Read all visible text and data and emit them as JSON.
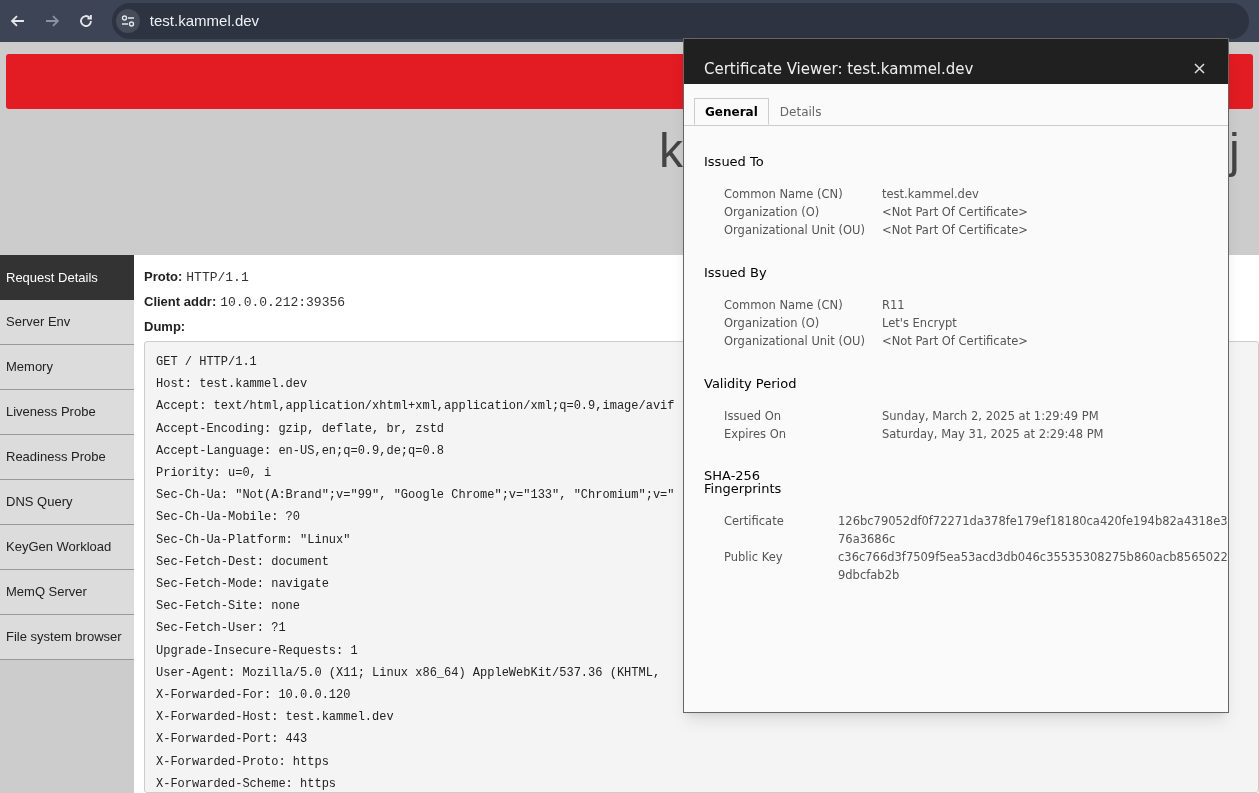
{
  "browser": {
    "url": "test.kammel.dev"
  },
  "page": {
    "title_start": "k",
    "title_end": "j",
    "sidebar": [
      {
        "label": "Request Details",
        "selected": true
      },
      {
        "label": "Server Env",
        "selected": false
      },
      {
        "label": "Memory",
        "selected": false
      },
      {
        "label": "Liveness Probe",
        "selected": false
      },
      {
        "label": "Readiness Probe",
        "selected": false
      },
      {
        "label": "DNS Query",
        "selected": false
      },
      {
        "label": "KeyGen Workload",
        "selected": false
      },
      {
        "label": "MemQ Server",
        "selected": false
      },
      {
        "label": "File system browser",
        "selected": false
      }
    ],
    "fields": [
      {
        "label": "Proto:",
        "value": "HTTP/1.1"
      },
      {
        "label": "Client addr:",
        "value": "10.0.0.212:39356"
      }
    ],
    "dump_label": "Dump:",
    "dump": [
      "GET / HTTP/1.1",
      "Host: test.kammel.dev",
      "Accept: text/html,application/xhtml+xml,application/xml;q=0.9,image/avif",
      "Accept-Encoding: gzip, deflate, br, zstd",
      "Accept-Language: en-US,en;q=0.9,de;q=0.8",
      "Priority: u=0, i",
      "Sec-Ch-Ua: \"Not(A:Brand\";v=\"99\", \"Google Chrome\";v=\"133\", \"Chromium\";v=\"",
      "Sec-Ch-Ua-Mobile: ?0",
      "Sec-Ch-Ua-Platform: \"Linux\"",
      "Sec-Fetch-Dest: document",
      "Sec-Fetch-Mode: navigate",
      "Sec-Fetch-Site: none",
      "Sec-Fetch-User: ?1",
      "Upgrade-Insecure-Requests: 1",
      "User-Agent: Mozilla/5.0 (X11; Linux x86_64) AppleWebKit/537.36 (KHTML,",
      "X-Forwarded-For: 10.0.0.120",
      "X-Forwarded-Host: test.kammel.dev",
      "X-Forwarded-Port: 443",
      "X-Forwarded-Proto: https",
      "X-Forwarded-Scheme: https"
    ]
  },
  "dialog": {
    "title": "Certificate Viewer: test.kammel.dev",
    "tabs": [
      {
        "label": "General",
        "selected": true
      },
      {
        "label": "Details",
        "selected": false
      }
    ],
    "sections": [
      {
        "heading": "Issued To",
        "kind": "names",
        "rows": [
          {
            "label": "Common Name (CN)",
            "value": "test.kammel.dev"
          },
          {
            "label": "Organization (O)",
            "value": "<Not Part Of Certificate>"
          },
          {
            "label": "Organizational Unit (OU)",
            "value": "<Not Part Of Certificate>"
          }
        ]
      },
      {
        "heading": "Issued By",
        "kind": "names",
        "rows": [
          {
            "label": "Common Name (CN)",
            "value": "R11"
          },
          {
            "label": "Organization (O)",
            "value": "Let's Encrypt"
          },
          {
            "label": "Organizational Unit (OU)",
            "value": "<Not Part Of Certificate>"
          }
        ]
      },
      {
        "heading": "Validity Period",
        "kind": "names",
        "rows": [
          {
            "label": "Issued On",
            "value": "Sunday, March 2, 2025 at 1:29:49 PM"
          },
          {
            "label": "Expires On",
            "value": "Saturday, May 31, 2025 at 2:29:48 PM"
          }
        ]
      },
      {
        "heading_lines": [
          "SHA-256",
          "Fingerprints"
        ],
        "kind": "hashes",
        "rows": [
          {
            "label": "Certificate",
            "value_lines": [
              "126bc79052df0f72271da378fe179ef18180ca420fe194b82a4318e3",
              "76a3686c"
            ]
          },
          {
            "label": "Public Key",
            "value_lines": [
              "c36c766d3f7509f5ea53acd3db046c35535308275b860acb8565022",
              "9dbcfab2b"
            ]
          }
        ]
      }
    ]
  }
}
